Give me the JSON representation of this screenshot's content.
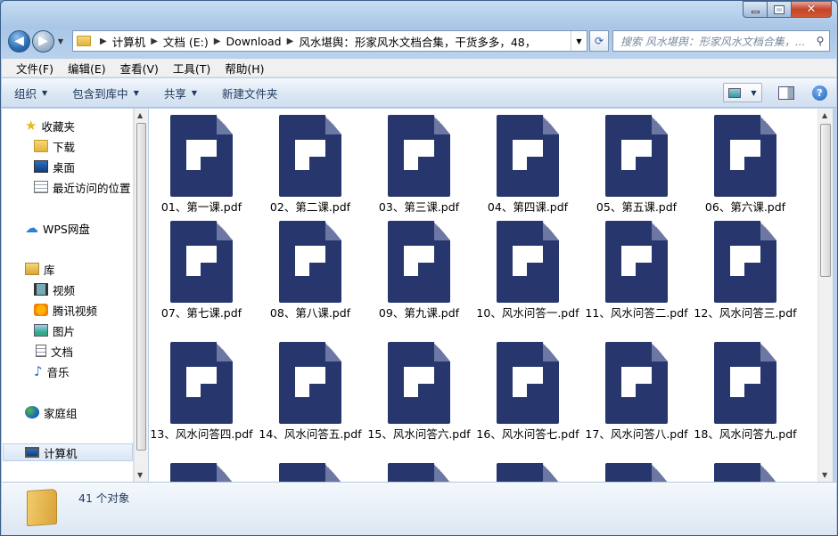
{
  "address": {
    "crumbs": [
      "计算机",
      "文档 (E:)",
      "Download",
      "风水堪舆：形家风水文档合集，干货多多，48，"
    ]
  },
  "search": {
    "placeholder": "搜索 风水堪舆：形家风水文档合集，..."
  },
  "menu": [
    "文件(F)",
    "编辑(E)",
    "查看(V)",
    "工具(T)",
    "帮助(H)"
  ],
  "toolbar": {
    "organize": "组织",
    "include": "包含到库中",
    "share": "共享",
    "new_folder": "新建文件夹"
  },
  "sidebar": {
    "favorites": "收藏夹",
    "downloads": "下载",
    "desktop": "桌面",
    "recent": "最近访问的位置",
    "wps": "WPS网盘",
    "library": "库",
    "video": "视频",
    "tencent_video": "腾讯视频",
    "pictures": "图片",
    "documents": "文档",
    "music": "音乐",
    "homegroup": "家庭组",
    "computer": "计算机"
  },
  "files": [
    "01、第一课.pdf",
    "02、第二课.pdf",
    "03、第三课.pdf",
    "04、第四课.pdf",
    "05、第五课.pdf",
    "06、第六课.pdf",
    "07、第七课.pdf",
    "08、第八课.pdf",
    "09、第九课.pdf",
    "10、风水问答一.pdf",
    "11、风水问答二.pdf",
    "12、风水问答三.pdf",
    "13、风水问答四.pdf",
    "14、风水问答五.pdf",
    "15、风水问答六.pdf",
    "16、风水问答七.pdf",
    "17、风水问答八.pdf",
    "18、风水问答九.pdf",
    "",
    "",
    "",
    "",
    "",
    ""
  ],
  "status": {
    "count": "41 个对象"
  }
}
